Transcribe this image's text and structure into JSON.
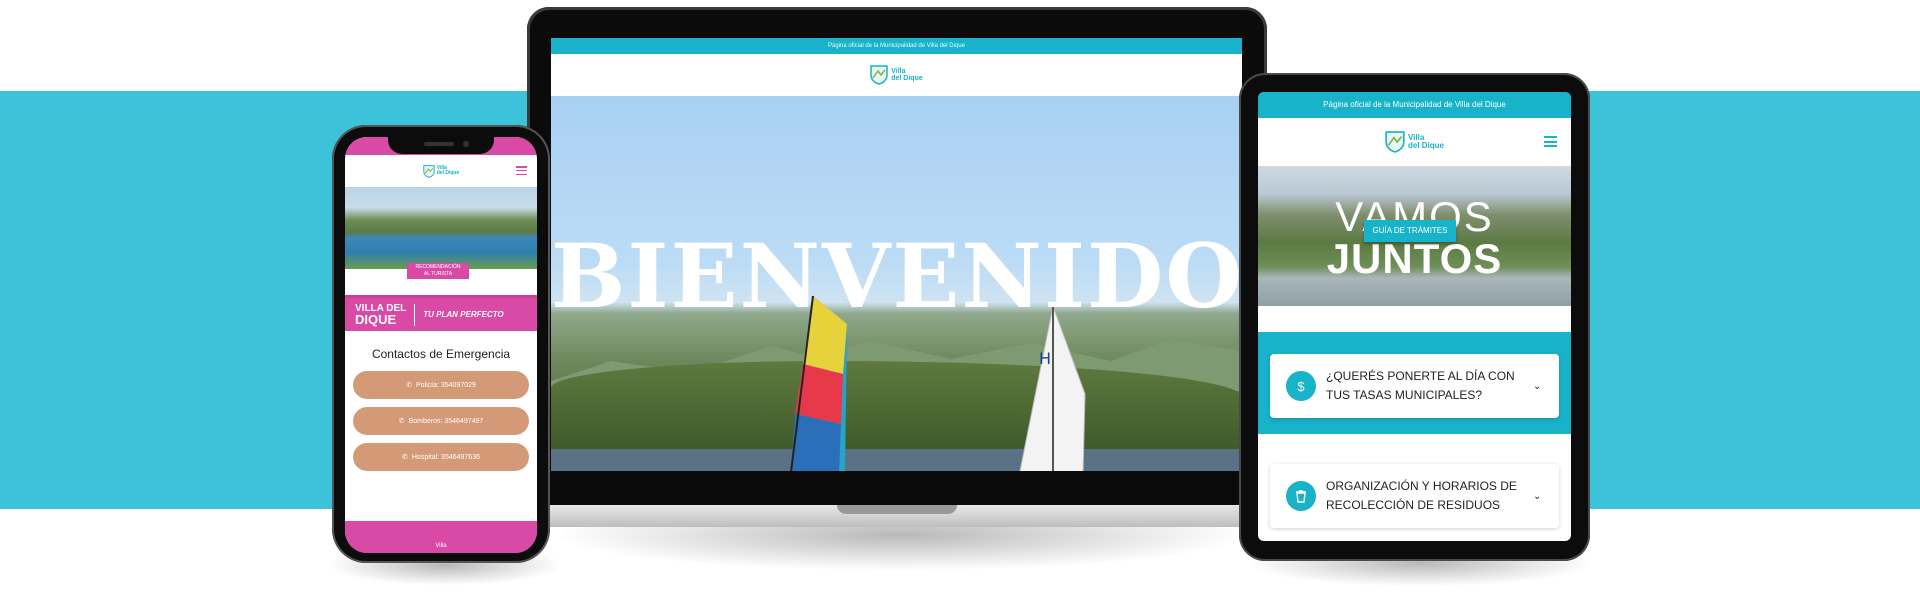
{
  "laptop": {
    "topbar_text": "Página oficial de la Municipalidad de Villa del Dique",
    "logo_line1": "Villa",
    "logo_line2": "del Dique",
    "hero_title": "BIENVENIDOS"
  },
  "phone": {
    "logo_line1": "Villa",
    "logo_line2": "del Dique",
    "hero_badge_line1": "RECOMENDACIÓN",
    "hero_badge_line2": "AL TURISTA",
    "banner_left_line1": "VILLA DEL",
    "banner_left_line2": "DIQUE",
    "banner_right": "TU PLAN PERFECTO",
    "emergency_title": "Contactos de Emergencia",
    "contacts": [
      {
        "label": "Policía: 354097029"
      },
      {
        "label": "Bomberos: 3546497497"
      },
      {
        "label": "Hospital: 3546497636"
      }
    ],
    "bottom_logo": "Villa"
  },
  "tablet": {
    "topbar_text": "Página oficial de la Municipalidad de Villa del Dique",
    "logo_line1": "Villa",
    "logo_line2": "del Dique",
    "hero_line1": "VAMOS",
    "hero_line2": "JUNTOS",
    "cta_label": "GUÍA DE TRÁMITES",
    "cards": [
      {
        "icon": "dollar-icon",
        "line1": "¿QUERÉS PONERTE AL DÍA CON",
        "line2": "TUS TASAS MUNICIPALES?"
      },
      {
        "icon": "trash-icon",
        "line1": "ORGANIZACIÓN Y HORARIOS DE",
        "line2": "RECOLECCIÓN DE RESIDUOS"
      }
    ]
  },
  "colors": {
    "brand_teal": "#18b2c9",
    "band": "#3cc3d9",
    "brand_pink": "#d94aa6",
    "button_tan": "#d49a78"
  }
}
